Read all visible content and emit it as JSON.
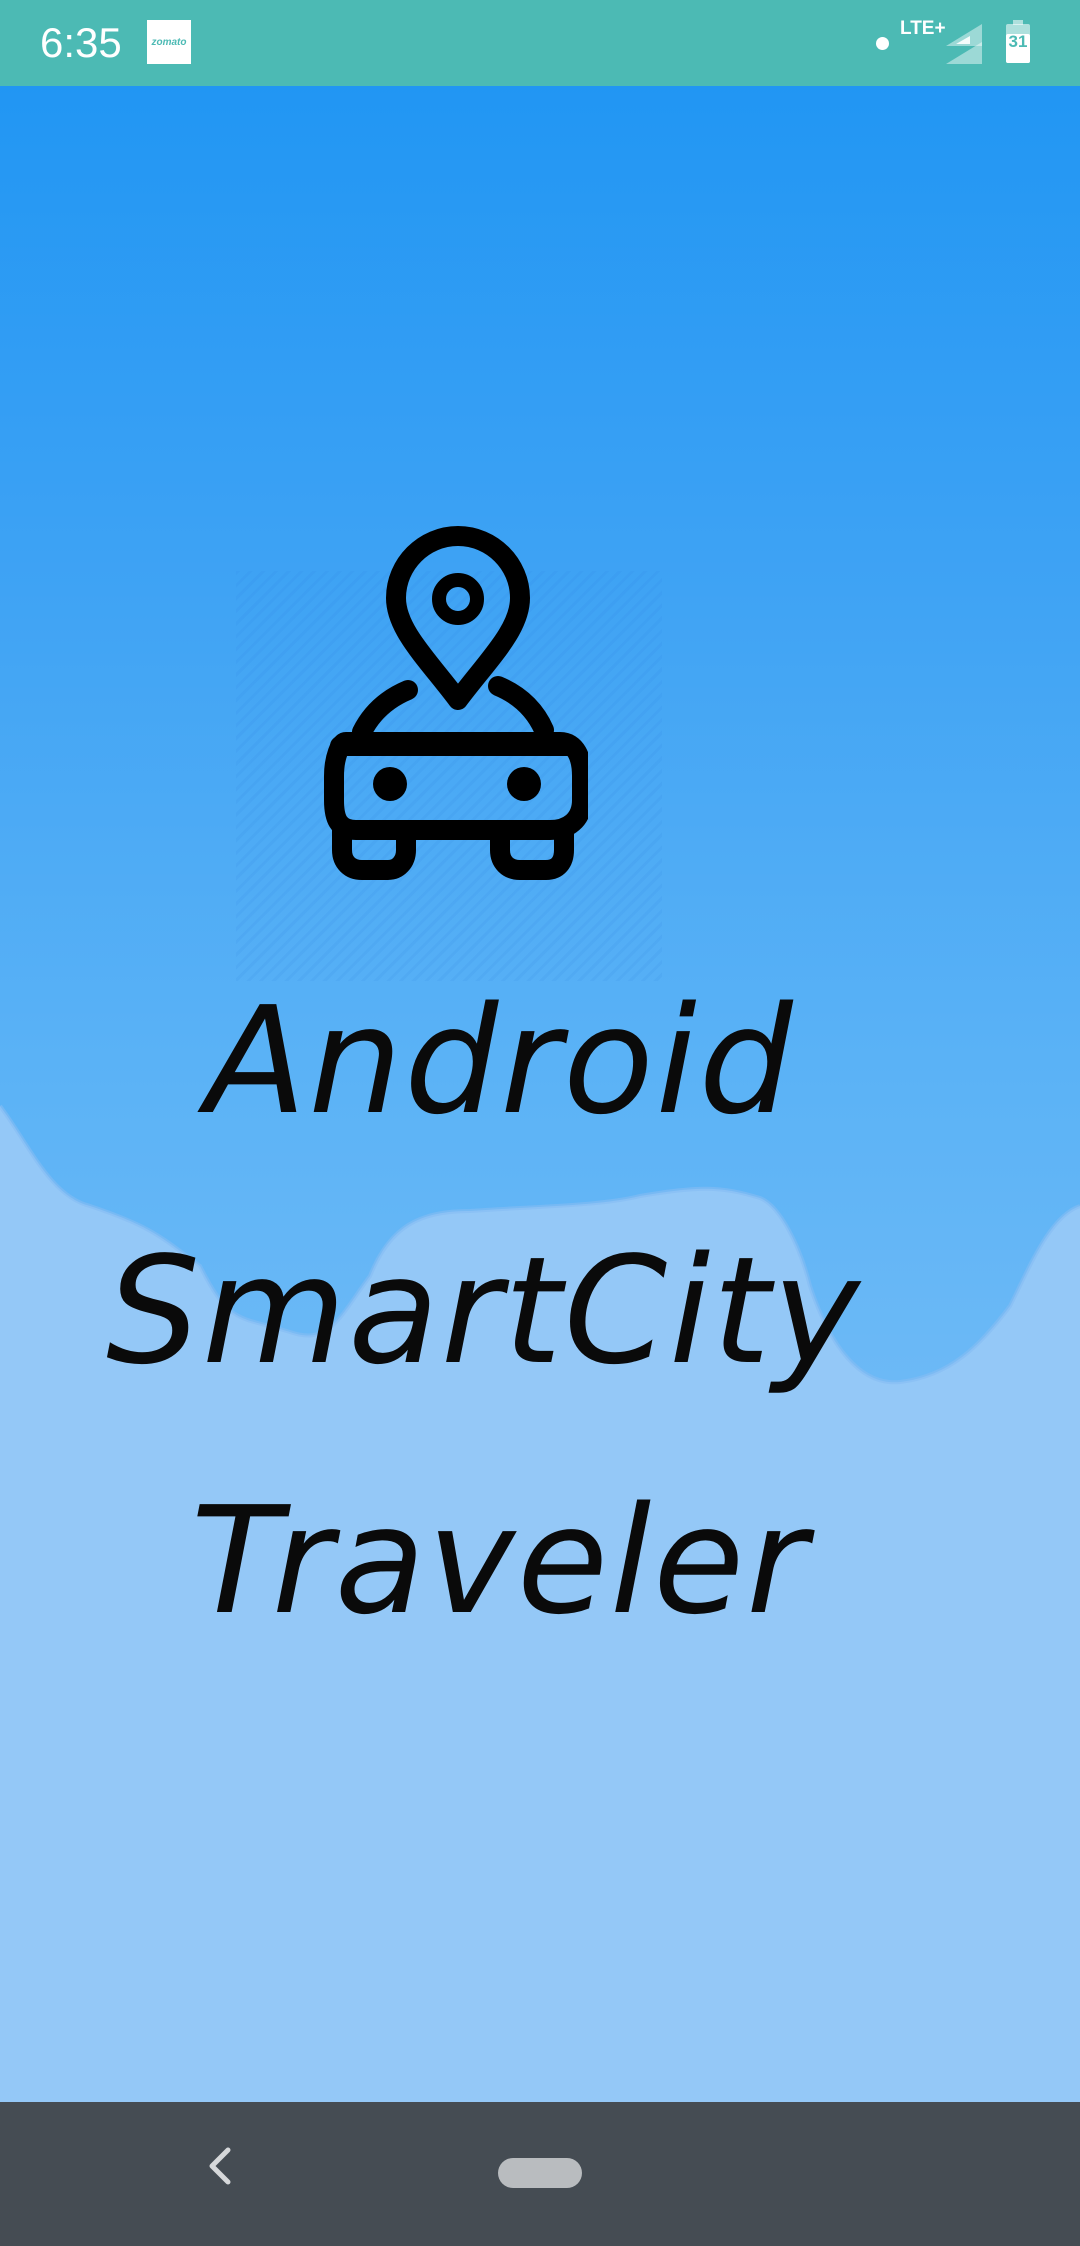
{
  "status_bar": {
    "time": "6:35",
    "notification_app_label": "zomato",
    "network_type": "LTE+",
    "battery_level": "31",
    "background_color": "#4cbab4",
    "icons": [
      "zomato-notification-icon",
      "dot-icon",
      "signal-icon",
      "battery-icon"
    ]
  },
  "splash": {
    "logo_icon": "location-pin-car-icon",
    "title_lines": [
      "Android",
      "SmartCity",
      "Traveler"
    ],
    "gradient_top_color": "#2196f3",
    "wave_color": "#94c8f7"
  },
  "nav_bar": {
    "icons": [
      "back-icon",
      "home-pill-icon"
    ],
    "background_color": "#454c53"
  }
}
